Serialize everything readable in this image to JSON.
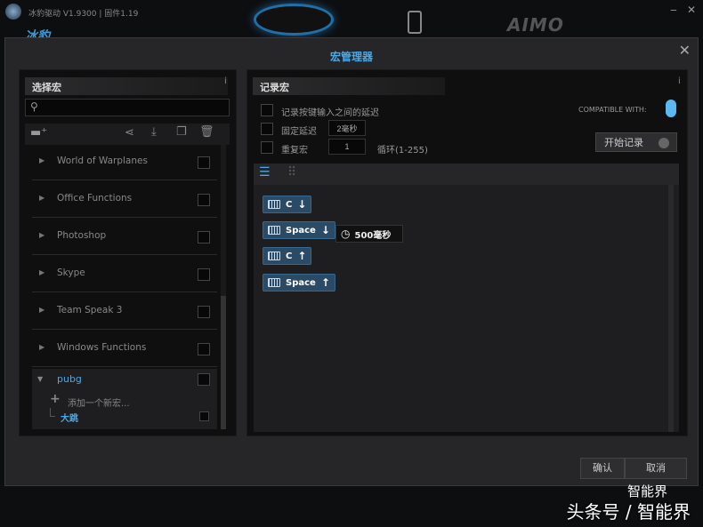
{
  "app": {
    "title": "冰豹驱动 V1.9300 | 固件1.19",
    "brand": "冰豹",
    "product": "AIMO",
    "min": "‒",
    "close": "✕"
  },
  "dialog": {
    "title": "宏管理器",
    "close": "✕",
    "left": {
      "header": "选择宏",
      "info": "i",
      "search_placeholder": "",
      "macros": [
        {
          "label": "World of Warplanes"
        },
        {
          "label": "Office Functions"
        },
        {
          "label": "Photoshop"
        },
        {
          "label": "Skype"
        },
        {
          "label": "Team Speak 3"
        },
        {
          "label": "Windows Functions"
        }
      ],
      "expanded": {
        "label": "pubg",
        "add_label": "添加一个新宏...",
        "children": [
          {
            "label": "大跳"
          }
        ]
      }
    },
    "right": {
      "header": "记录宏",
      "info": "i",
      "opt_record_delay": "记录按键输入之间的延迟",
      "opt_fixed_delay": "固定延迟",
      "fixed_delay_value": "2毫秒",
      "opt_repeat": "重复宏",
      "repeat_value": "1",
      "repeat_hint": "循环(1-255)",
      "compatible": "COMPATIBLE WITH:",
      "record_button": "开始记录",
      "steps": [
        {
          "key": "C",
          "dir": "↓"
        },
        {
          "key": "Space",
          "dir": "↓"
        },
        {
          "key": "C",
          "dir": "↑"
        },
        {
          "key": "Space",
          "dir": "↑"
        }
      ],
      "delay": "500毫秒"
    },
    "ok": "确认",
    "cancel": "取消"
  },
  "watermark": {
    "line1": "智能界",
    "line2": "头条号 / 智能界"
  },
  "colors": {
    "accent": "#4aa8e8",
    "chip": "#2a4a66"
  }
}
